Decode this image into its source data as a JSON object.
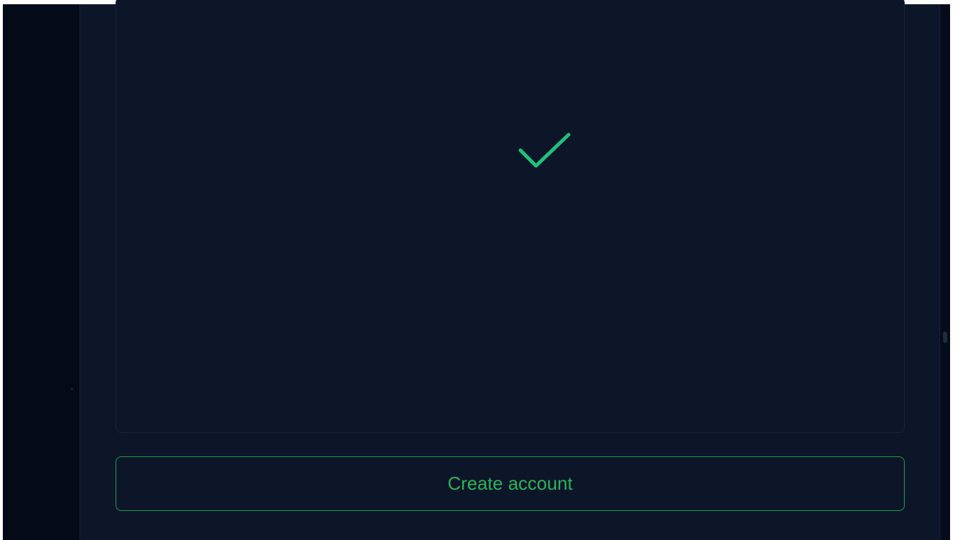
{
  "app": {
    "background_color": "#0d1629",
    "accent_color": "#2bb35a"
  },
  "content": {
    "status_icon": "checkmark-icon",
    "status_icon_color": "#1fc27a"
  },
  "actions": {
    "create_account_label": "Create account"
  }
}
